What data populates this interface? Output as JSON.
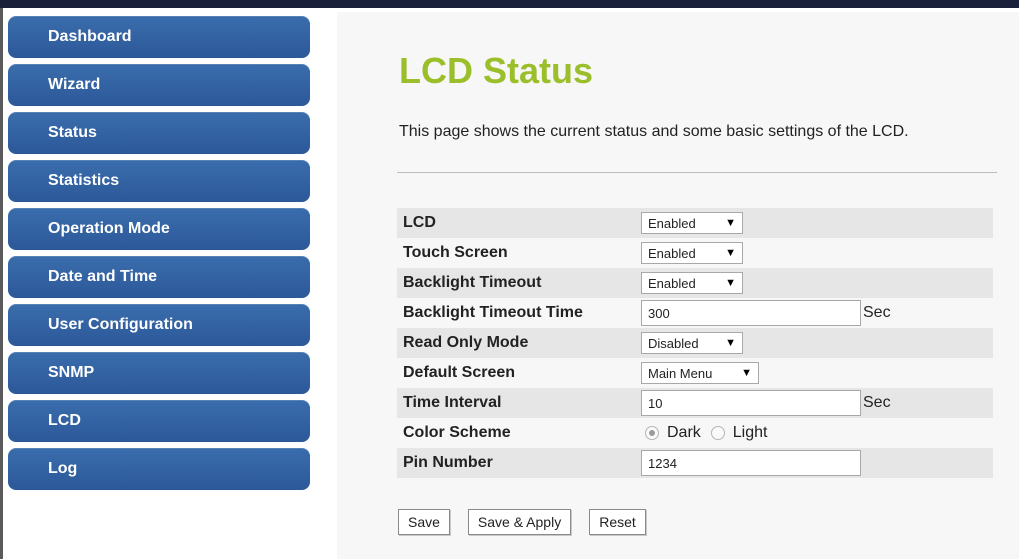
{
  "sidebar": {
    "items": [
      {
        "label": "Dashboard"
      },
      {
        "label": "Wizard"
      },
      {
        "label": "Status"
      },
      {
        "label": "Statistics"
      },
      {
        "label": "Operation Mode"
      },
      {
        "label": "Date and Time"
      },
      {
        "label": "User Configuration"
      },
      {
        "label": "SNMP"
      },
      {
        "label": "LCD"
      },
      {
        "label": "Log"
      }
    ]
  },
  "main": {
    "title": "LCD Status",
    "title_color": "#9bbf2b",
    "description": "This page shows the current status and some basic settings of the LCD.",
    "form": {
      "lcd": {
        "label": "LCD",
        "value": "Enabled"
      },
      "touch_screen": {
        "label": "Touch Screen",
        "value": "Enabled"
      },
      "backlight_timeout": {
        "label": "Backlight Timeout",
        "value": "Enabled"
      },
      "backlight_timeout_time": {
        "label": "Backlight Timeout Time",
        "value": "300",
        "unit": "Sec"
      },
      "read_only_mode": {
        "label": "Read Only Mode",
        "value": "Disabled"
      },
      "default_screen": {
        "label": "Default Screen",
        "value": "Main Menu"
      },
      "time_interval": {
        "label": "Time Interval",
        "value": "10",
        "unit": "Sec"
      },
      "color_scheme": {
        "label": "Color Scheme",
        "options": [
          "Dark",
          "Light"
        ],
        "selected": "Dark"
      },
      "pin_number": {
        "label": "Pin Number",
        "value": "1234"
      }
    },
    "buttons": {
      "save": "Save",
      "save_apply": "Save & Apply",
      "reset": "Reset"
    }
  },
  "colors": {
    "nav_button": "#2f5d9e",
    "row_shade": "#e6e6e6",
    "main_background": "#f7f7f7"
  }
}
